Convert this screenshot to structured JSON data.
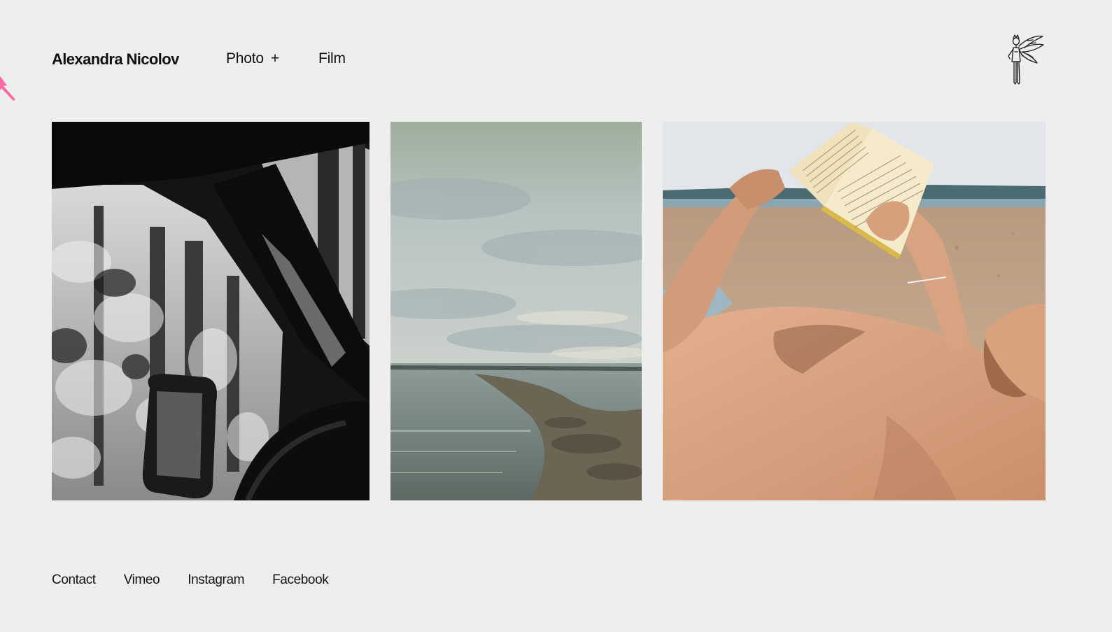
{
  "header": {
    "site_title": "Alexandra Nicolov",
    "nav": [
      {
        "label": "Photo",
        "expand_symbol": "+"
      },
      {
        "label": "Film"
      }
    ],
    "logo_icon": "fairy-figure-icon"
  },
  "gallery": [
    {
      "icon": "car-window-forest-photo",
      "tone": "black-and-white"
    },
    {
      "icon": "seascape-shoreline-photo",
      "tone": "muted-color"
    },
    {
      "icon": "man-reading-on-beach-photo",
      "tone": "warm-color"
    }
  ],
  "footer": {
    "links": [
      "Contact",
      "Vimeo",
      "Instagram",
      "Facebook"
    ]
  },
  "colors": {
    "background": "#eeeeee",
    "text": "#111111",
    "cursor": "#ff5a9a"
  }
}
